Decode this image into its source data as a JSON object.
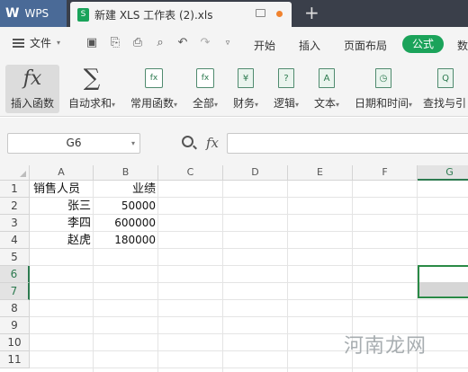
{
  "app": {
    "logo": "W",
    "name": "WPS"
  },
  "tab": {
    "icon_text": "S",
    "title": "新建 XLS 工作表 (2).xls",
    "new_tab": "+"
  },
  "menubar": {
    "file_label": "文件",
    "items": [
      "开始",
      "插入",
      "页面布局",
      "数"
    ],
    "active": "公式"
  },
  "ribbon": {
    "insert_function": "插入函数",
    "autosum": "自动求和",
    "common_functions": "常用函数",
    "all": "全部",
    "finance": "财务",
    "logic": "逻辑",
    "text": "文本",
    "datetime": "日期和时间",
    "lookup": "查找与引",
    "fx_glyph": "fx",
    "sigma_glyph": "∑",
    "finance_glyph": "¥",
    "logic_glyph": "?",
    "text_glyph": "A",
    "datetime_glyph": "◷",
    "lookup_glyph": "Q",
    "caret": "▾"
  },
  "formula_bar": {
    "name_box": "G6",
    "fx": "fx",
    "value": ""
  },
  "grid": {
    "columns": [
      "A",
      "B",
      "C",
      "D",
      "E",
      "F",
      "G"
    ],
    "selected_column": "G",
    "rows": [
      "1",
      "2",
      "3",
      "4",
      "5",
      "6",
      "7",
      "8",
      "9",
      "10",
      "11"
    ],
    "selected_rows": [
      "6",
      "7"
    ],
    "cells": {
      "A1": "销售人员",
      "B1": "业绩",
      "A2": "张三",
      "B2": "50000",
      "A3": "李四",
      "B3": "600000",
      "A4": "赵虎",
      "B4": "180000"
    },
    "selection": "G6"
  },
  "watermark": "河南龙网",
  "colors": {
    "accent": "#1ba35a",
    "titlebar": "#3a3f4a",
    "app_tab": "#4a6a97",
    "selection": "#2a8a46"
  }
}
